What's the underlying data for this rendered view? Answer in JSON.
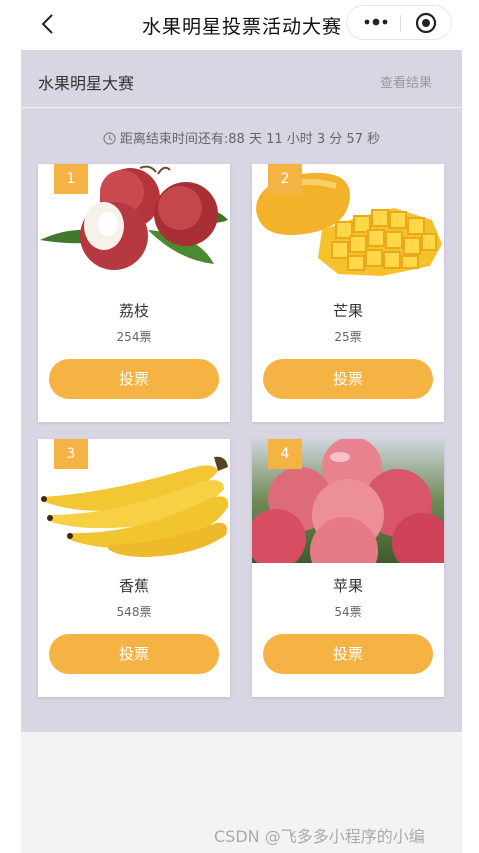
{
  "nav": {
    "title": "水果明星投票活动大赛"
  },
  "header": {
    "title": "水果明星大赛",
    "link": "查看结果"
  },
  "countdown": {
    "text": "距离结束时间还有:88 天 11 小时 3 分 57 秒"
  },
  "cards": [
    {
      "rank": "1",
      "name": "荔枝",
      "votes": "254票",
      "button": "投票",
      "image": "lychee-image"
    },
    {
      "rank": "2",
      "name": "芒果",
      "votes": "25票",
      "button": "投票",
      "image": "mango-image"
    },
    {
      "rank": "3",
      "name": "香蕉",
      "votes": "548票",
      "button": "投票",
      "image": "banana-image"
    },
    {
      "rank": "4",
      "name": "苹果",
      "votes": "54票",
      "button": "投票",
      "image": "apple-image"
    }
  ],
  "watermark": "CSDN @飞多多小程序的小编",
  "colors": {
    "accent": "#f5b343",
    "page_bg": "#d8d6e3"
  }
}
